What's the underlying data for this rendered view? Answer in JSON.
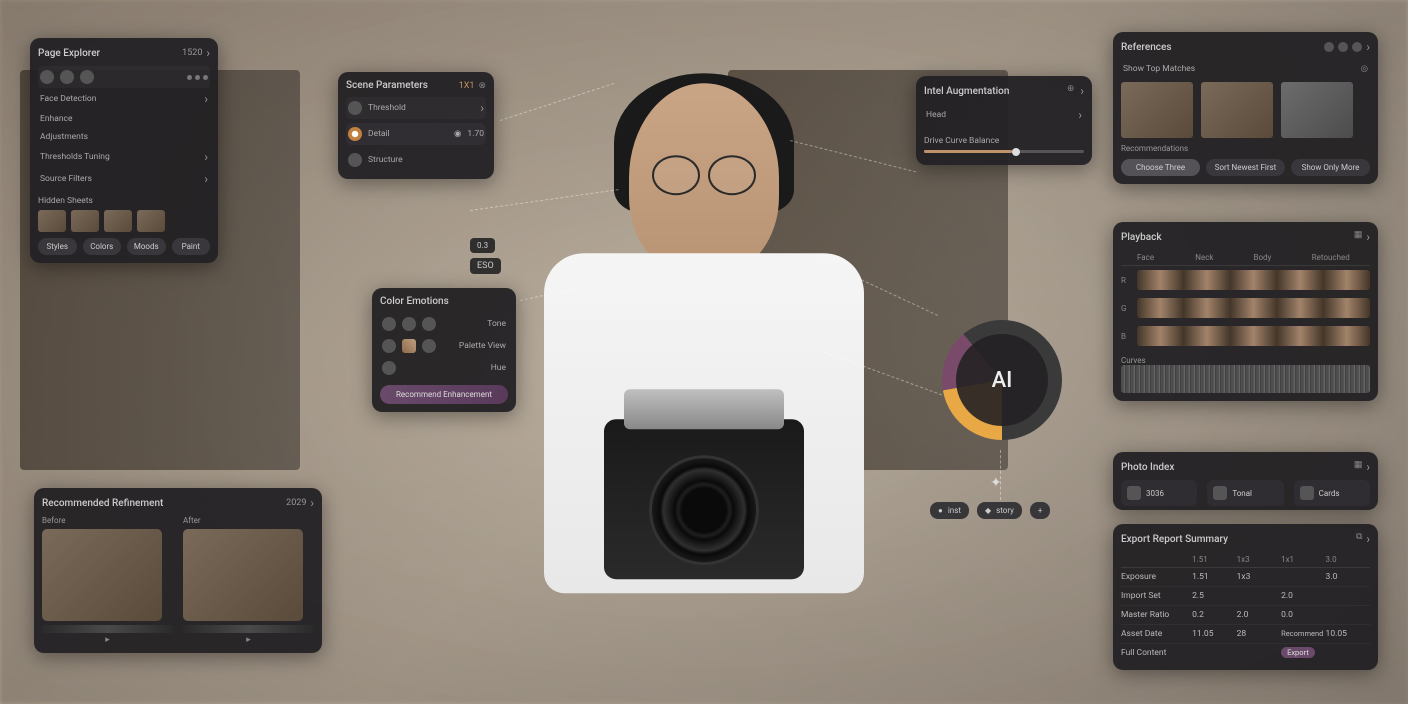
{
  "left_top": {
    "title": "Page Explorer",
    "value": "1520",
    "rows": [
      {
        "label": "Face Detection",
        "val": ""
      },
      {
        "label": "Enhance",
        "val": ""
      },
      {
        "label": "Adjustments",
        "val": ""
      },
      {
        "label": "Thresholds Tuning",
        "val": ""
      },
      {
        "label": "Source Filters",
        "val": ""
      }
    ],
    "thumb_title": "Hidden Sheets",
    "pills": [
      "Styles",
      "Colors",
      "Moods",
      "Paint"
    ]
  },
  "panel_scene": {
    "title": "Scene Parameters",
    "badge": "1X1",
    "row1": {
      "label": "Threshold"
    },
    "row2": {
      "label": "Detail",
      "icon": "eye-icon",
      "val": "1.70"
    },
    "row3": {
      "label": "Structure"
    }
  },
  "panel_color": {
    "title": "Color Emotions",
    "rows": [
      {
        "label": "Tone"
      },
      {
        "label": "Palette View"
      },
      {
        "label": "Hue"
      }
    ],
    "button": "Recommend Enhancement"
  },
  "float_center": {
    "label": "ESO",
    "val": "0.3"
  },
  "panel_intel": {
    "title": "Intel Augmentation",
    "sub": "Head",
    "slider_label": "Drive Curve Balance",
    "slider_pct": 55
  },
  "ai_label": "AI",
  "chips": [
    {
      "icon": "circle-icon",
      "label": "inst"
    },
    {
      "icon": "diamond-icon",
      "label": "story"
    },
    {
      "icon": "plus-icon",
      "label": ""
    }
  ],
  "panel_recommend": {
    "title": "Recommended Refinement",
    "value": "2029",
    "labels": [
      "Before",
      "After"
    ]
  },
  "panel_ref": {
    "title": "References",
    "sub": "Show Top Matches",
    "pills": [
      "Choose Three",
      "Sort Newest First",
      "Show Only More"
    ],
    "recommend": "Recommendations"
  },
  "panel_waves": {
    "title": "Playback",
    "head": [
      "Face",
      "Neck",
      "Body",
      "Retouched"
    ],
    "rows": [
      "R",
      "G",
      "B"
    ],
    "spectrum": "Curves"
  },
  "panel_index": {
    "title": "Photo Index",
    "items": [
      {
        "icon": "camera-icon",
        "label": "3036"
      },
      {
        "icon": "image-icon",
        "label": "Tonal"
      },
      {
        "icon": "stack-icon",
        "label": "Cards"
      }
    ]
  },
  "panel_report": {
    "title": "Export Report Summary",
    "head": [
      "",
      "1.51",
      "1x3",
      "1x1",
      "3.0"
    ],
    "rows": [
      {
        "label": "Exposure",
        "v": [
          "1.51",
          "1x3",
          "",
          "3.0"
        ]
      },
      {
        "label": "Import Set",
        "v": [
          "2.5",
          "",
          "2.0",
          ""
        ]
      },
      {
        "label": "Master Ratio",
        "v": [
          "0.2",
          "2.0",
          "0.0",
          ""
        ]
      },
      {
        "label": "Asset Date",
        "v": [
          "11.05",
          "28",
          "Recommend",
          "10.05"
        ]
      },
      {
        "label": "Full Content",
        "v": [
          "",
          "",
          "Export",
          ""
        ]
      }
    ]
  }
}
